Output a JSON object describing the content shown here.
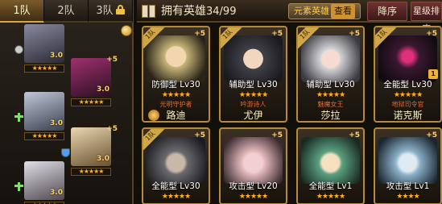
{
  "team_tabs": [
    {
      "label": "1队",
      "active": true
    },
    {
      "label": "2队",
      "active": false
    },
    {
      "label": "3队",
      "active": false,
      "locked": true
    }
  ],
  "formation": [
    {
      "level": "3.0",
      "stars": "★★★★★",
      "plus": "",
      "role_icon": "gear-icon",
      "color": "#5a5a66"
    },
    {
      "level": "3.0",
      "stars": "★★★★★",
      "plus": "+5",
      "role_icon": "",
      "color": "#6a2050"
    },
    {
      "level": "3.0",
      "stars": "★★★★★",
      "plus": "",
      "role_icon": "cross-icon",
      "color": "#4a5a70"
    },
    {
      "level": "3.0",
      "stars": "★★★★★",
      "plus": "+5",
      "role_icon": "shield-icon",
      "color": "#d0b080"
    },
    {
      "level": "3.0",
      "stars": "★★★★★",
      "plus": "",
      "role_icon": "cross-icon",
      "color": "#a8a8b0"
    }
  ],
  "header": {
    "title": "拥有英雄",
    "count": "34/99",
    "element_label": "元素英雄",
    "view_label": "查看",
    "sort_desc": "降序",
    "sort_star": "星级排序"
  },
  "heroes": [
    {
      "team": "1队",
      "plus": "+5",
      "type_level": "防御型 Lv30",
      "stars": "★★★★★",
      "subtitle": "光明守护者",
      "name": "路迪",
      "badge": true,
      "corner": "",
      "art_color": "#c9b77a"
    },
    {
      "team": "1队",
      "plus": "+5",
      "type_level": "辅助型 Lv30",
      "stars": "★★★★★",
      "subtitle": "吟游诗人",
      "name": "尤伊",
      "badge": false,
      "corner": "",
      "art_color": "#404048"
    },
    {
      "team": "1队",
      "plus": "+5",
      "type_level": "辅助型 Lv30",
      "stars": "★★★★★",
      "subtitle": "魅魔女王",
      "name": "莎拉",
      "badge": false,
      "corner": "",
      "art_color": "#d8d8dc"
    },
    {
      "team": "1队",
      "plus": "+5",
      "type_level": "全能型 Lv30",
      "stars": "★★★★★",
      "subtitle": "地狱司令官",
      "name": "诺克斯",
      "badge": false,
      "corner": "1",
      "art_color": "#3a1830"
    },
    {
      "team": "1队",
      "plus": "+5",
      "type_level": "全能型 Lv30",
      "stars": "★★★★★",
      "subtitle": "",
      "name": "",
      "badge": false,
      "corner": "",
      "art_color": "#6a6a6e"
    },
    {
      "team": "",
      "plus": "+5",
      "type_level": "攻击型 Lv20",
      "stars": "★★★★★",
      "subtitle": "",
      "name": "",
      "badge": false,
      "corner": "",
      "art_color": "#e2b8bc"
    },
    {
      "team": "",
      "plus": "+5",
      "type_level": "全能型 Lv1",
      "stars": "★★★★★",
      "subtitle": "",
      "name": "",
      "badge": false,
      "corner": "",
      "art_color": "#5aa080"
    },
    {
      "team": "",
      "plus": "+5",
      "type_level": "攻击型 Lv1",
      "stars": "★★★★",
      "subtitle": "",
      "name": "",
      "badge": false,
      "corner": "",
      "art_color": "#8ab0c8"
    }
  ]
}
